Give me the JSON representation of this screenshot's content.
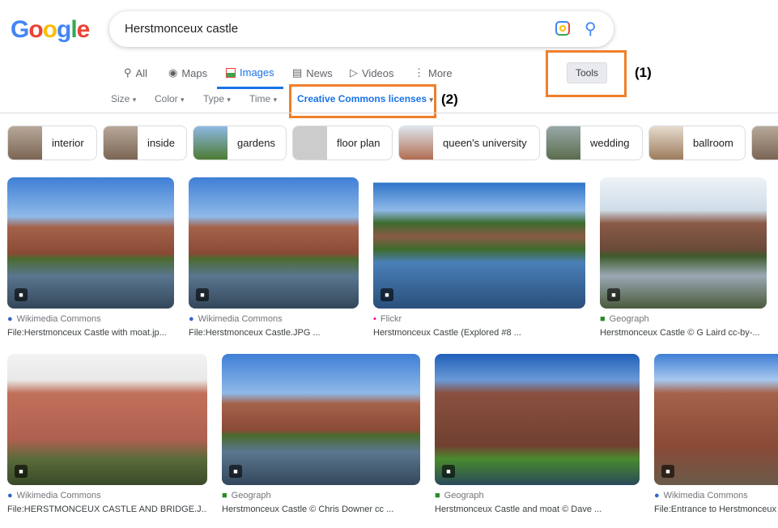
{
  "logo": {
    "letters": [
      "G",
      "o",
      "o",
      "g",
      "l",
      "e"
    ],
    "colors": [
      "#4285f4",
      "#ea4335",
      "#fbbc05",
      "#4285f4",
      "#34a853",
      "#ea4335"
    ]
  },
  "search": {
    "query": "Herstmonceux castle"
  },
  "tabs": [
    {
      "label": "All",
      "icon": "search-icon"
    },
    {
      "label": "Maps",
      "icon": "map-pin-icon"
    },
    {
      "label": "Images",
      "icon": "image-icon",
      "active": true
    },
    {
      "label": "News",
      "icon": "news-icon"
    },
    {
      "label": "Videos",
      "icon": "play-icon"
    },
    {
      "label": "More",
      "icon": "more-vert-icon"
    }
  ],
  "filters": [
    "Size",
    "Color",
    "Type",
    "Time",
    "Creative Commons licenses"
  ],
  "tools_label": "Tools",
  "annotations": [
    "(1)",
    "(2)"
  ],
  "chips": [
    "interior",
    "inside",
    "gardens",
    "floor plan",
    "queen's university",
    "wedding",
    "ballroom"
  ],
  "results": [
    {
      "source": "Wikimedia Commons",
      "title": "File:Herstmonceux Castle with moat.jp..."
    },
    {
      "source": "Wikimedia Commons",
      "title": "File:Herstmonceux Castle.JPG ..."
    },
    {
      "source": "Flickr",
      "title": "Herstmonceux Castle (Explored #8 ..."
    },
    {
      "source": "Geograph",
      "title": "Herstmonceux Castle © G Laird cc-by-..."
    },
    {
      "source": "Wikimedia Commons",
      "title": "File:HERSTMONCEUX CASTLE AND BRIDGE.J..."
    },
    {
      "source": "Geograph",
      "title": "Herstmonceux Castle © Chris Downer cc ..."
    },
    {
      "source": "Geograph",
      "title": "Herstmonceux Castle and moat © Dave ..."
    },
    {
      "source": "Wikimedia Commons",
      "title": "File:Entrance to Herstmonceux"
    }
  ],
  "colors": {
    "accent": "#1a73e8",
    "highlight": "#f07f2a"
  }
}
